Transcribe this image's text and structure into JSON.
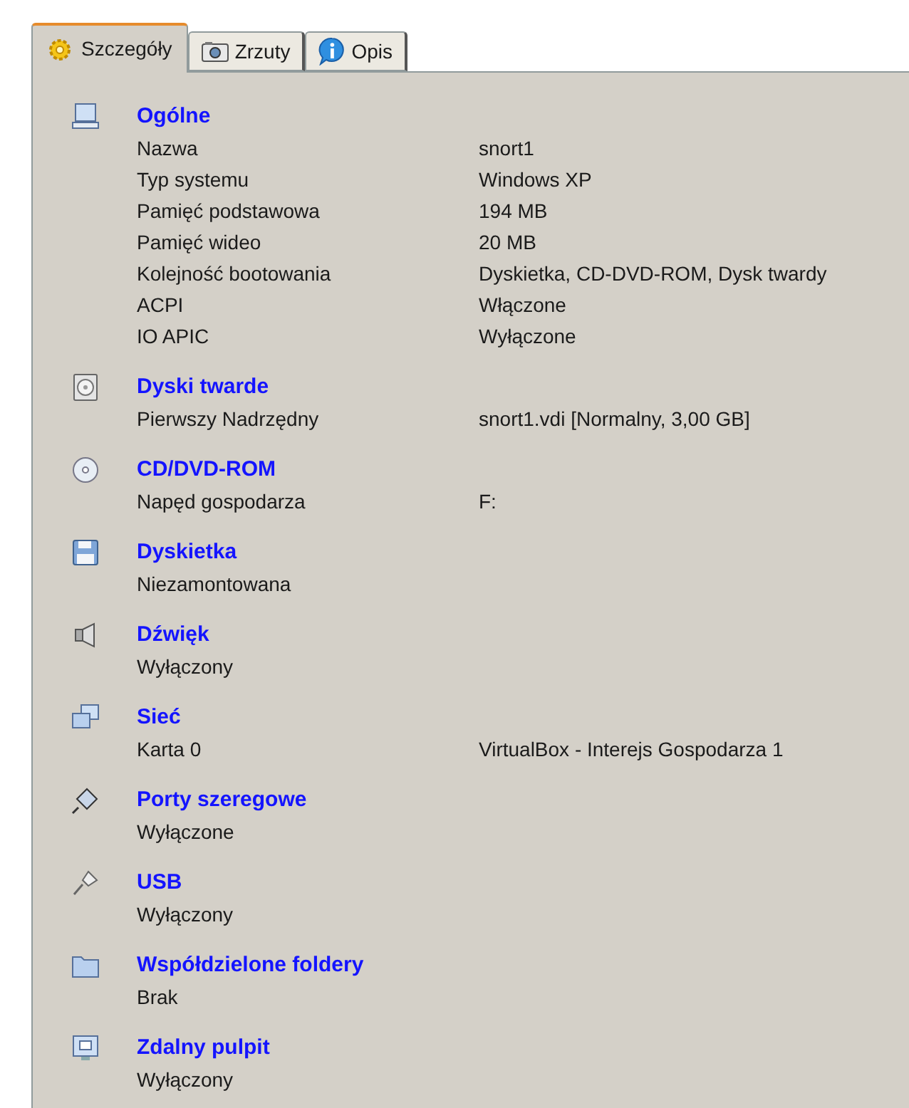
{
  "tabs": [
    {
      "label": "Szczegóły",
      "kind": "gear",
      "selected": true
    },
    {
      "label": "Zrzuty",
      "kind": "camera",
      "selected": false
    },
    {
      "label": "Opis",
      "kind": "info",
      "selected": false
    }
  ],
  "sections": [
    {
      "title": "Ogólne",
      "kind": "computer",
      "rows": [
        {
          "label": "Nazwa",
          "value": "snort1"
        },
        {
          "label": "Typ systemu",
          "value": "Windows XP"
        },
        {
          "label": "Pamięć podstawowa",
          "value": "194 MB"
        },
        {
          "label": "Pamięć wideo",
          "value": "20 MB"
        },
        {
          "label": "Kolejność bootowania",
          "value": "Dyskietka, CD-DVD-ROM, Dysk twardy"
        },
        {
          "label": "ACPI",
          "value": "Włączone"
        },
        {
          "label": "IO APIC",
          "value": "Wyłączone"
        }
      ]
    },
    {
      "title": "Dyski twarde",
      "kind": "disk",
      "rows": [
        {
          "label": "Pierwszy Nadrzędny",
          "value": "snort1.vdi [Normalny, 3,00 GB]"
        }
      ]
    },
    {
      "title": "CD/DVD-ROM",
      "kind": "cd",
      "rows": [
        {
          "label": "Napęd gospodarza",
          "value": "F:"
        }
      ]
    },
    {
      "title": "Dyskietka",
      "kind": "floppy",
      "rows": [
        {
          "label": "Niezamontowana"
        }
      ]
    },
    {
      "title": "Dźwięk",
      "kind": "sound",
      "rows": [
        {
          "label": "Wyłączony"
        }
      ]
    },
    {
      "title": "Sieć",
      "kind": "network",
      "rows": [
        {
          "label": "Karta 0",
          "value": "VirtualBox - Interejs Gospodarza 1"
        }
      ]
    },
    {
      "title": "Porty szeregowe",
      "kind": "serial",
      "rows": [
        {
          "label": "Wyłączone"
        }
      ]
    },
    {
      "title": "USB",
      "kind": "usb",
      "rows": [
        {
          "label": "Wyłączony"
        }
      ]
    },
    {
      "title": "Współdzielone foldery",
      "kind": "folder",
      "rows": [
        {
          "label": "Brak"
        }
      ]
    },
    {
      "title": "Zdalny pulpit",
      "kind": "remote",
      "rows": [
        {
          "label": "Wyłączony"
        }
      ]
    }
  ]
}
